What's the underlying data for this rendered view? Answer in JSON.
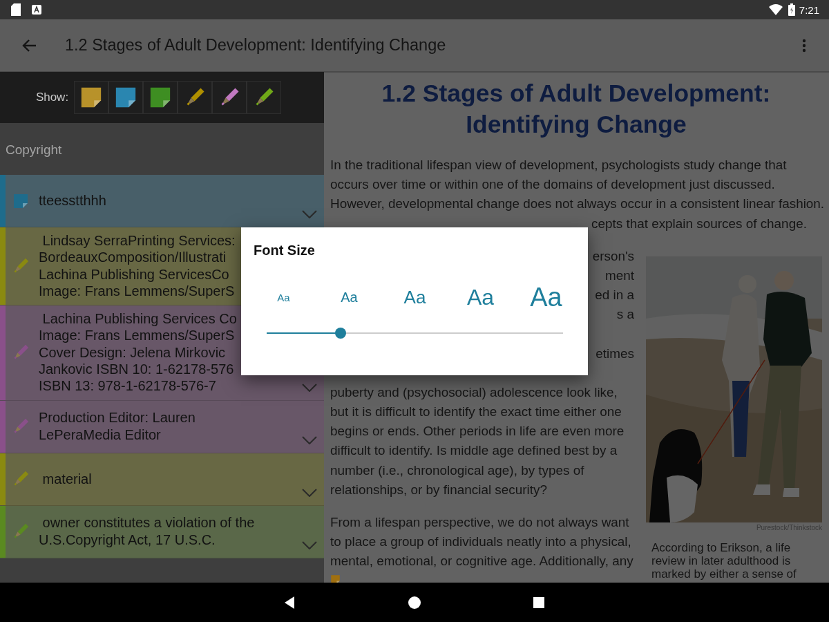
{
  "status_bar": {
    "time": "7:21"
  },
  "toolbar": {
    "title": "1.2 Stages of Adult Development: Identifying Change"
  },
  "sidebar": {
    "show_label": "Show:",
    "filters": [
      {
        "kind": "note",
        "color": "#b8922a"
      },
      {
        "kind": "note",
        "color": "#2a86b0"
      },
      {
        "kind": "note",
        "color": "#3e8e22"
      },
      {
        "kind": "highlight",
        "color": "#b09000"
      },
      {
        "kind": "highlight",
        "color": "#c078c0"
      },
      {
        "kind": "highlight",
        "color": "#70a818"
      }
    ],
    "items": [
      {
        "kind": "header",
        "title": "Copyright"
      },
      {
        "kind": "note",
        "color": "#1e6c8c",
        "chevron": true,
        "lines": [
          "tteesstthhh"
        ]
      },
      {
        "kind": "highlight",
        "color": "#8a8a10",
        "chevron": false,
        "lines": [
          " Lindsay SerraPrinting Services:",
          "BordeauxComposition/Illustrati",
          "Lachina Publishing ServicesCo",
          "Image: Frans Lemmens/SuperS"
        ]
      },
      {
        "kind": "highlight",
        "color": "#8a508a",
        "chevron": true,
        "lines": [
          " Lachina Publishing Services Co",
          "Image: Frans Lemmens/SuperS",
          "Cover Design: Jelena Mirkovic",
          "Jankovic ISBN 10: 1-62178-576",
          "ISBN 13: 978-1-62178-576-7"
        ]
      },
      {
        "kind": "highlight",
        "color": "#8a508a",
        "chevron": true,
        "lines": [
          "Production Editor: Lauren",
          "LePeraMedia Editor"
        ]
      },
      {
        "kind": "highlight",
        "color": "#8a8a10",
        "chevron": true,
        "lines": [
          " material"
        ]
      },
      {
        "kind": "highlight",
        "color": "#5a8a20",
        "chevron": true,
        "lines": [
          " owner constitutes a violation of the",
          "U.S.Copyright Act, 17 U.S.C."
        ]
      }
    ]
  },
  "reader": {
    "heading": "1.2 Stages of Adult Development: Identifying Change",
    "paragraphs": [
      {
        "kind": "full",
        "lines": [
          "In the traditional lifespan view of development, psychologists study change that",
          "occurs over time or within one of the domains of development just discussed.",
          "However, developmental change does not always occur in a consistent linear fashion."
        ],
        "cut_line": "cepts that explain sources of change."
      },
      {
        "kind": "partial",
        "fragments": [
          [
            "erson's",
            "ment",
            "ed in a",
            "s a"
          ],
          [
            "etimes"
          ]
        ],
        "lines": [
          "puberty and (psychosocial) adolescence look like,",
          "but it is difficult to identify the exact time either one",
          "begins or ends. Other periods in life are even more",
          "difficult to identify. Is middle age defined best by a",
          "number (i.e., chronological age), by types of",
          "relationships, or by financial security?"
        ]
      },
      {
        "kind": "full",
        "lines": [
          "From a lifespan perspective, we do not always want",
          "to place a group of individuals neatly into a physical,",
          "mental, emotional, or cognitive age. Additionally, any"
        ]
      }
    ],
    "figure": {
      "kind": "picture",
      "credit": "Purestock/Thinkstock",
      "caption_lines": [
        "According to Erikson, a life",
        "review in later adulthood is",
        "marked by either a sense of"
      ]
    }
  },
  "dialog": {
    "title": "Font Size",
    "options": [
      "Aa",
      "Aa",
      "Aa",
      "Aa",
      "Aa"
    ],
    "level": 0.25
  }
}
